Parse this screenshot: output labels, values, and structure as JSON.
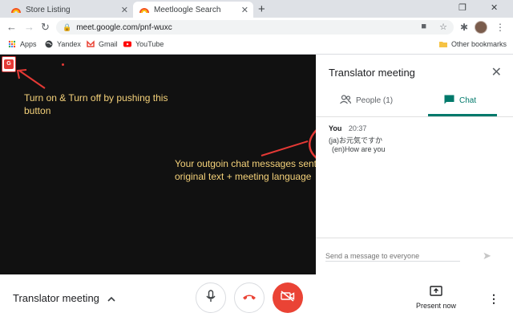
{
  "browser": {
    "tabs": [
      {
        "label": "Store Listing"
      },
      {
        "label": "Meetloogle Search"
      }
    ],
    "new_tab": "+",
    "url": "meet.google.com/pnf-wuxc",
    "bookmarks": [
      {
        "label": "Apps"
      },
      {
        "label": "Yandex"
      },
      {
        "label": "Gmail"
      },
      {
        "label": "YouTube"
      }
    ],
    "other_bookmarks": "Other bookmarks"
  },
  "panel": {
    "title": "Translator meeting",
    "tabs": {
      "people": "People (1)",
      "chat": "Chat"
    },
    "message": {
      "sender": "You",
      "time": "20:37",
      "line1": "(ja)お元気ですか",
      "line2": "(en)How are you"
    },
    "compose_placeholder": "Send a message to everyone"
  },
  "annotations": {
    "toggle_hint_1": "Turn on & Turn off by pushing this",
    "toggle_hint_2": "button",
    "chat_hint_1": "Your outgoin chat messages sent",
    "chat_hint_2": "original text +  meeting language"
  },
  "extension": {
    "badge": "G"
  },
  "bottom_bar": {
    "meeting_name": "Translator meeting",
    "present_label": "Present now"
  },
  "colors": {
    "accent": "#00796b",
    "hangup": "#ea4335",
    "annotation_red": "#e53935",
    "annotation_text": "#f5d27a"
  }
}
